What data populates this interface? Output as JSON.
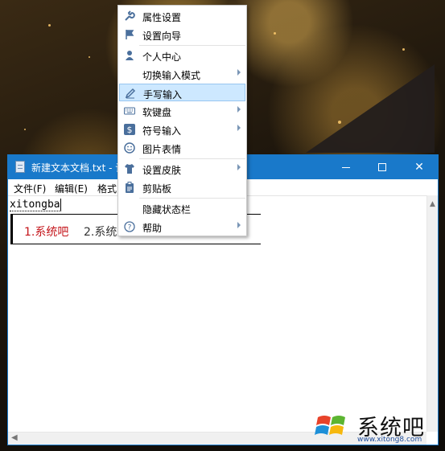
{
  "notepad": {
    "title": "新建文本文档.txt - 记",
    "menu": [
      "文件(F)",
      "编辑(E)",
      "格式"
    ],
    "typed_text": "xitongba",
    "candidates": [
      "1.系统吧",
      "2.系统"
    ]
  },
  "context_menu": {
    "items": [
      {
        "label": "属性设置",
        "icon": "wrench-icon",
        "submenu": false
      },
      {
        "label": "设置向导",
        "icon": "flag-icon",
        "submenu": false
      },
      {
        "label": "个人中心",
        "icon": "person-icon",
        "submenu": false
      },
      {
        "label": "切换输入模式",
        "icon": "",
        "submenu": true
      },
      {
        "label": "手写输入",
        "icon": "pen-icon",
        "submenu": false,
        "highlighted": true
      },
      {
        "label": "软键盘",
        "icon": "keyboard-icon",
        "submenu": true
      },
      {
        "label": "符号输入",
        "icon": "dollar-icon",
        "submenu": true
      },
      {
        "label": "图片表情",
        "icon": "smiley-icon",
        "submenu": false
      },
      {
        "label": "设置皮肤",
        "icon": "shirt-icon",
        "submenu": true
      },
      {
        "label": "剪贴板",
        "icon": "clipboard-icon",
        "submenu": false
      },
      {
        "label": "隐藏状态栏",
        "icon": "",
        "submenu": false
      },
      {
        "label": "帮助",
        "icon": "help-icon",
        "submenu": true
      }
    ]
  },
  "watermark": {
    "text": "系统吧",
    "url": "www.xitong8.com"
  },
  "colors": {
    "titlebar": "#1979ca",
    "highlight": "#cde8ff",
    "candidate_selected": "#c4141a"
  }
}
